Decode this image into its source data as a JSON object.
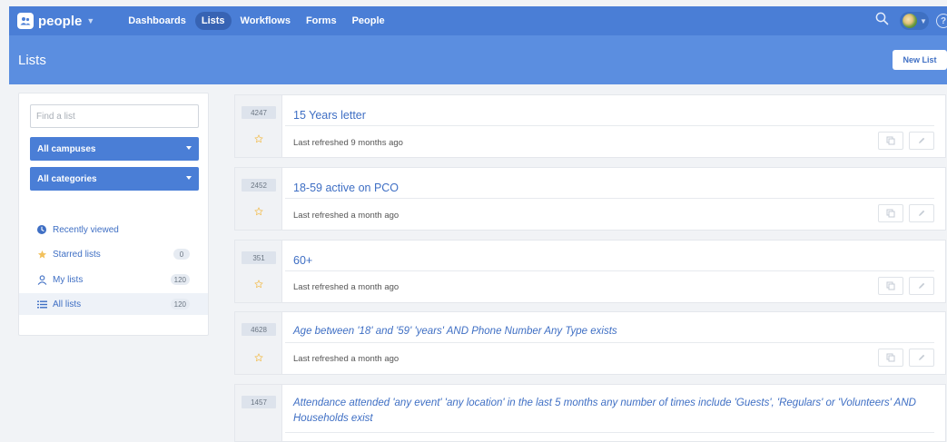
{
  "app": {
    "name": "people",
    "nav": [
      {
        "label": "Dashboards",
        "active": false
      },
      {
        "label": "Lists",
        "active": true
      },
      {
        "label": "Workflows",
        "active": false
      },
      {
        "label": "Forms",
        "active": false
      },
      {
        "label": "People",
        "active": false
      }
    ],
    "icons": {
      "logo": "people-logo-icon",
      "search": "search-icon",
      "help": "help-icon"
    }
  },
  "page": {
    "title": "Lists",
    "new_button": "New List"
  },
  "sidebar": {
    "search_placeholder": "Find a list",
    "campus_select": "All campuses",
    "category_select": "All categories",
    "items": [
      {
        "label": "Recently viewed",
        "icon": "clock-icon",
        "count": null
      },
      {
        "label": "Starred lists",
        "icon": "star-icon",
        "count": "0"
      },
      {
        "label": "My lists",
        "icon": "person-icon",
        "count": "120"
      },
      {
        "label": "All lists",
        "icon": "list-icon",
        "count": "120",
        "active": true
      }
    ]
  },
  "lists": [
    {
      "count": "4247",
      "name": "15 Years letter",
      "refreshed": "Last refreshed 9 months ago"
    },
    {
      "count": "2452",
      "name": "18-59 active on PCO",
      "refreshed": "Last refreshed a month ago"
    },
    {
      "count": "351",
      "name": "60+",
      "refreshed": "Last refreshed a month ago"
    },
    {
      "count": "4628",
      "name": "Age between '18' and '59' 'years' AND Phone Number Any Type exists",
      "refreshed": "Last refreshed a month ago"
    },
    {
      "count": "1457",
      "name": "Attendance attended 'any event' 'any location' in the last 5 months any number of times include 'Guests', 'Regulars' or 'Volunteers' AND Households exist",
      "refreshed": ""
    }
  ],
  "colors": {
    "primary": "#4a7ed6",
    "header": "#5b8ee0",
    "link": "#3f6fc4",
    "star": "#f2c15c"
  }
}
